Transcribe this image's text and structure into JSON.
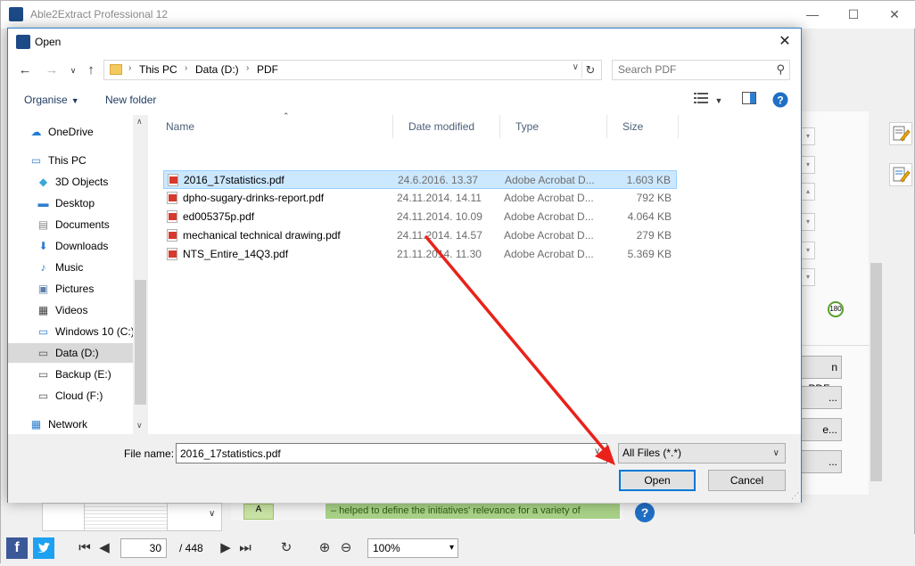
{
  "app": {
    "title": "Able2Extract Professional 12",
    "win_min": "—",
    "win_max": "☐",
    "win_close": "✕",
    "side_panel": {
      "btn_pdf": "n PDF...",
      "btn_2": "...",
      "btn_3": "e...",
      "btn_4": "...",
      "rotate_label": "180"
    },
    "doc_strip": {
      "tag": "A",
      "text": "– helped to define the initiatives' relevance for a variety of"
    },
    "help_glyph": "?",
    "bottom_bar": {
      "page_current": "30",
      "page_total": "/ 448",
      "zoom": "100%"
    }
  },
  "dialog": {
    "title": "Open",
    "breadcrumb": [
      "This PC",
      "Data (D:)",
      "PDF"
    ],
    "search_placeholder": "Search PDF",
    "organise_label": "Organise",
    "new_folder_label": "New folder",
    "nav_items": [
      {
        "label": "OneDrive",
        "icon": "cloud-icon",
        "color": "#1e7bd8"
      },
      {
        "label": "This PC",
        "icon": "computer-icon",
        "color": "#3a86c8"
      },
      {
        "label": "3D Objects",
        "icon": "cube-icon",
        "color": "#39a7d6"
      },
      {
        "label": "Desktop",
        "icon": "desktop-icon",
        "color": "#2d7fd0"
      },
      {
        "label": "Documents",
        "icon": "documents-icon",
        "color": "#8a8a8a"
      },
      {
        "label": "Downloads",
        "icon": "download-icon",
        "color": "#2d7fd0"
      },
      {
        "label": "Music",
        "icon": "music-icon",
        "color": "#2d7fd0"
      },
      {
        "label": "Pictures",
        "icon": "pictures-icon",
        "color": "#5b7fa8"
      },
      {
        "label": "Videos",
        "icon": "video-icon",
        "color": "#444444"
      },
      {
        "label": "Windows 10 (C:)",
        "icon": "drive-windows-icon",
        "color": "#2d7fd0"
      },
      {
        "label": "Data (D:)",
        "icon": "drive-icon",
        "color": "#555555",
        "selected": true
      },
      {
        "label": "Backup (E:)",
        "icon": "drive-icon",
        "color": "#555555"
      },
      {
        "label": "Cloud (F:)",
        "icon": "drive-icon",
        "color": "#555555"
      },
      {
        "label": "Network",
        "icon": "network-icon",
        "color": "#2d7fd0"
      }
    ],
    "columns": {
      "name": "Name",
      "date": "Date modified",
      "type": "Type",
      "size": "Size"
    },
    "files": [
      {
        "name": "2016_17statistics.pdf",
        "date": "24.6.2016. 13.37",
        "type": "Adobe Acrobat D...",
        "size": "1.603 KB",
        "selected": true
      },
      {
        "name": "dpho-sugary-drinks-report.pdf",
        "date": "24.11.2014. 14.11",
        "type": "Adobe Acrobat D...",
        "size": "792 KB"
      },
      {
        "name": "ed005375p.pdf",
        "date": "24.11.2014. 10.09",
        "type": "Adobe Acrobat D...",
        "size": "4.064 KB"
      },
      {
        "name": "mechanical technical drawing.pdf",
        "date": "24.11.2014. 14.57",
        "type": "Adobe Acrobat D...",
        "size": "279 KB"
      },
      {
        "name": "NTS_Entire_14Q3.pdf",
        "date": "21.11.2014. 11.30",
        "type": "Adobe Acrobat D...",
        "size": "5.369 KB"
      }
    ],
    "file_name_label": "File name:",
    "file_name_value": "2016_17statistics.pdf",
    "file_type": "All Files (*.*)",
    "open_label": "Open",
    "cancel_label": "Cancel"
  },
  "colors": {
    "accent": "#0078d7",
    "selection": "#cce8ff",
    "annotation_arrow": "#e8221b"
  }
}
